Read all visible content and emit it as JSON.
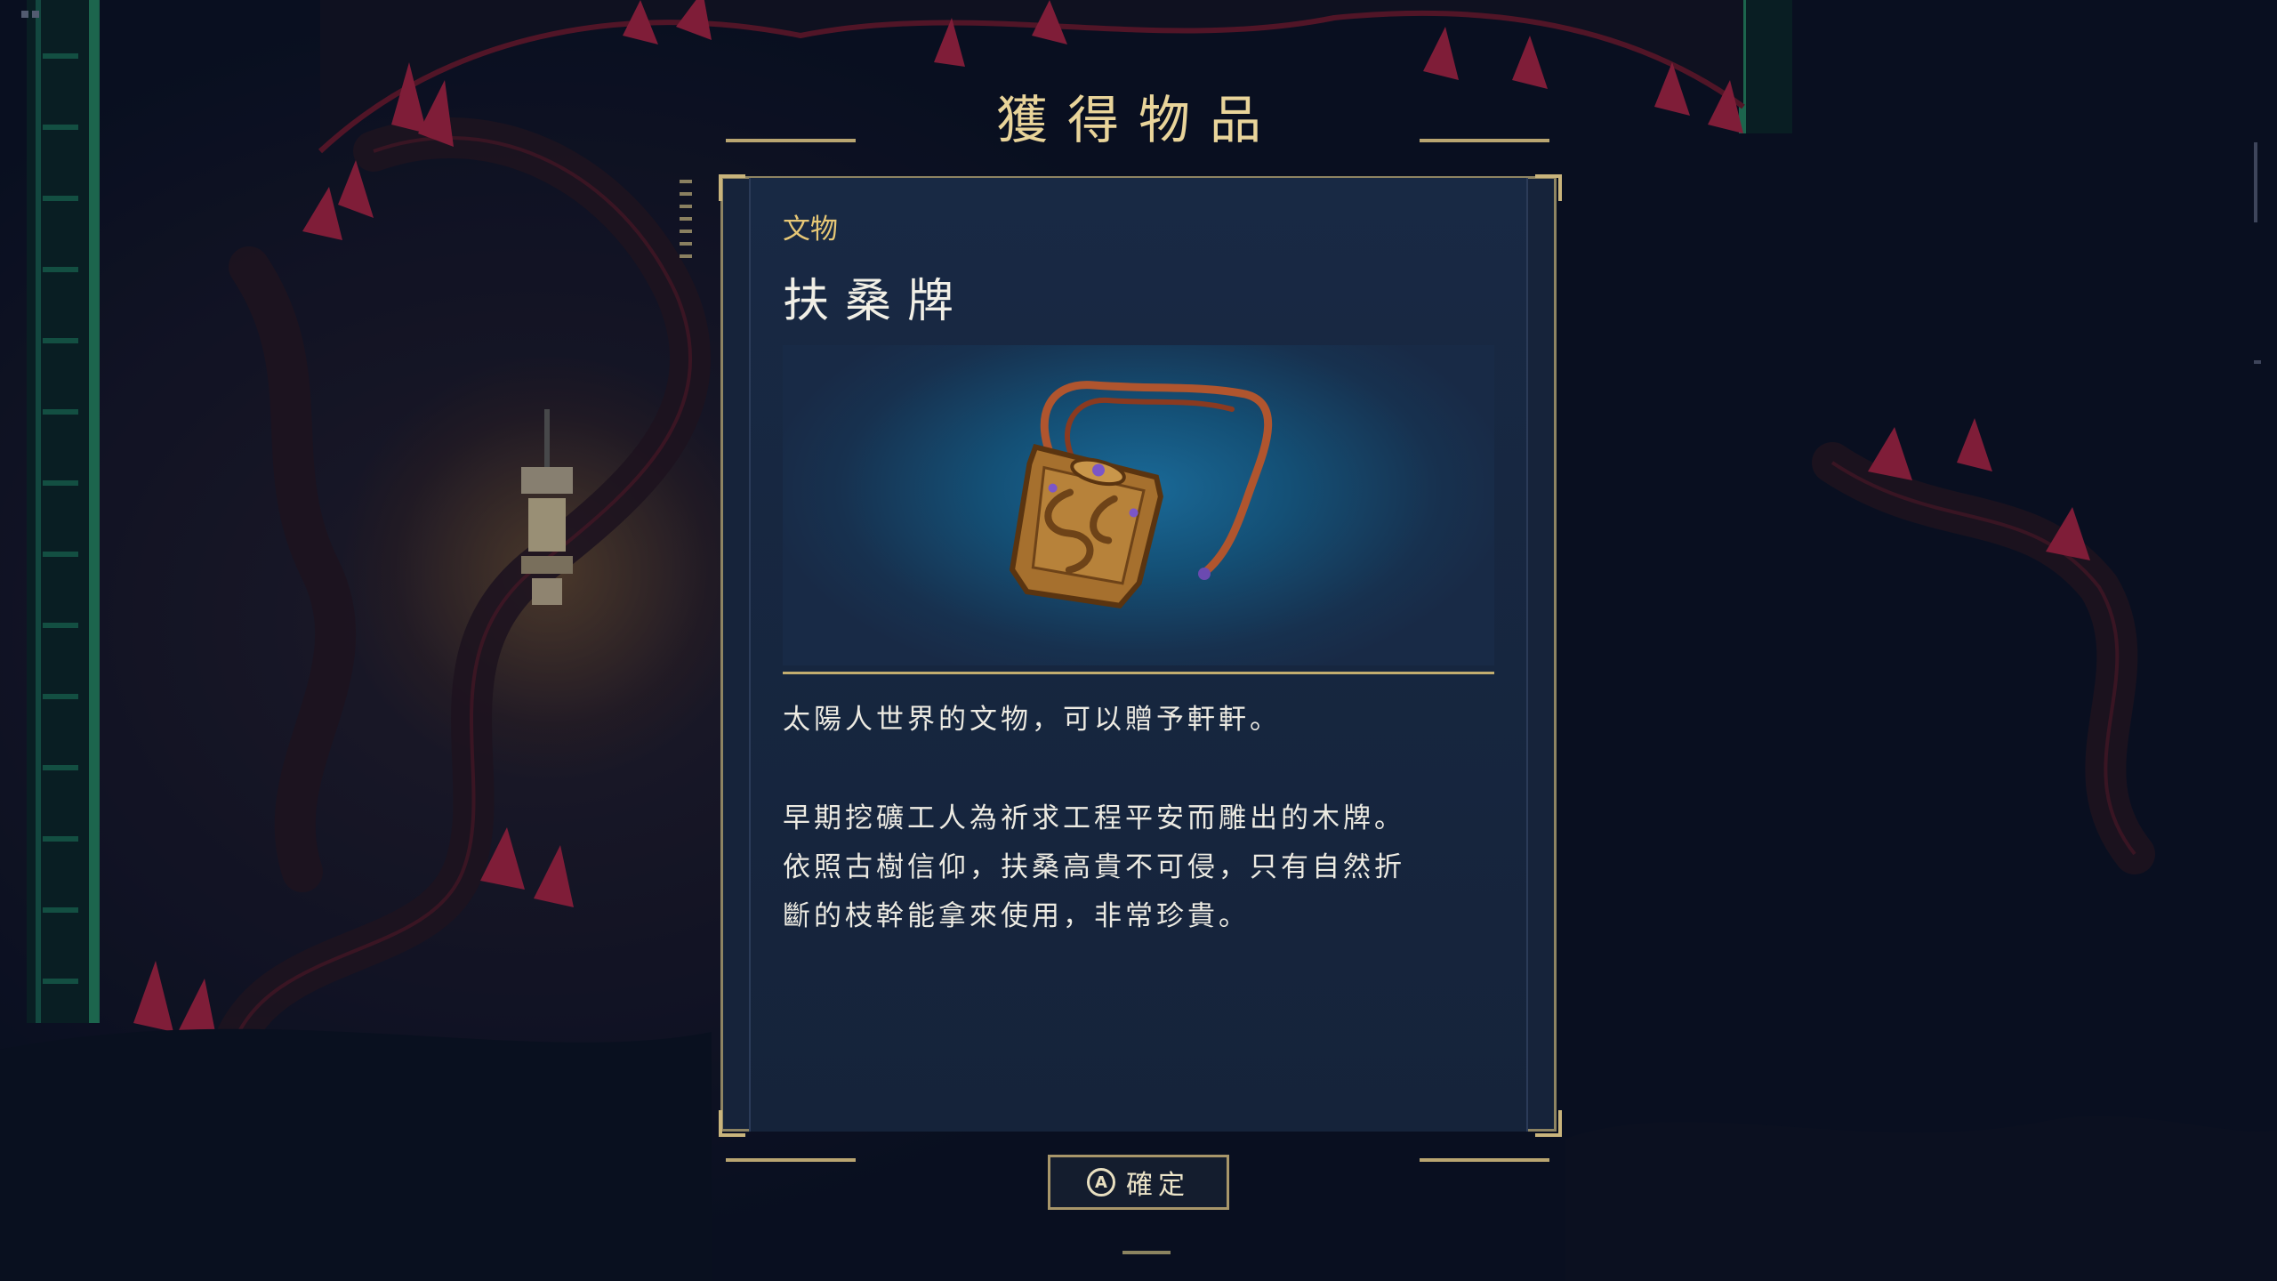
{
  "dialog": {
    "title": "獲得物品",
    "category": "文物",
    "item_name": "扶桑牌",
    "description_short": "太陽人世界的文物，可以贈予軒軒。",
    "description_lines": [
      "早期挖礦工人為祈求工程平安而雕出的木牌。",
      "依照古樹信仰，扶桑高貴不可侵，只有自然折",
      "斷的枝幹能拿來使用，非常珍貴。"
    ],
    "confirm_button": {
      "icon_label": "A",
      "label": "確定"
    }
  },
  "item_icon": "wooden-amulet-icon",
  "colors": {
    "accent_gold": "#e9d49a",
    "panel_border": "#8e8462",
    "crystal_red": "#c0284a",
    "vine_green": "#2fb37a"
  }
}
